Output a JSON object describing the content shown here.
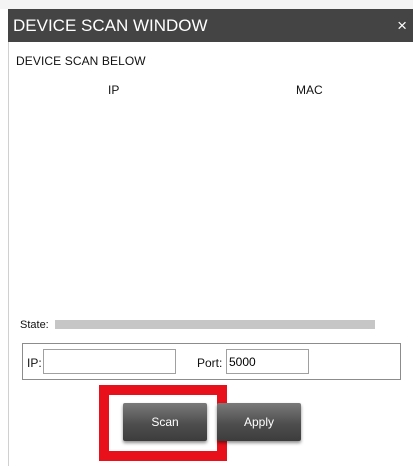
{
  "window": {
    "title": "DEVICE SCAN WINDOW",
    "close_glyph": "×",
    "close_icon": "close-icon"
  },
  "scan_section": {
    "heading": "DEVICE SCAN BELOW",
    "columns": [
      "IP",
      "MAC"
    ],
    "rows": []
  },
  "state": {
    "label": "State:"
  },
  "connection": {
    "ip_label": "IP:",
    "ip_value": "",
    "port_label": "Port:",
    "port_value": "5000"
  },
  "buttons": {
    "scan_label": "Scan",
    "apply_label": "Apply"
  },
  "colors": {
    "titlebar": "#444444",
    "highlight": "#e8101a",
    "button": "#4e4e4e",
    "state_bar": "#c6c6c6"
  }
}
